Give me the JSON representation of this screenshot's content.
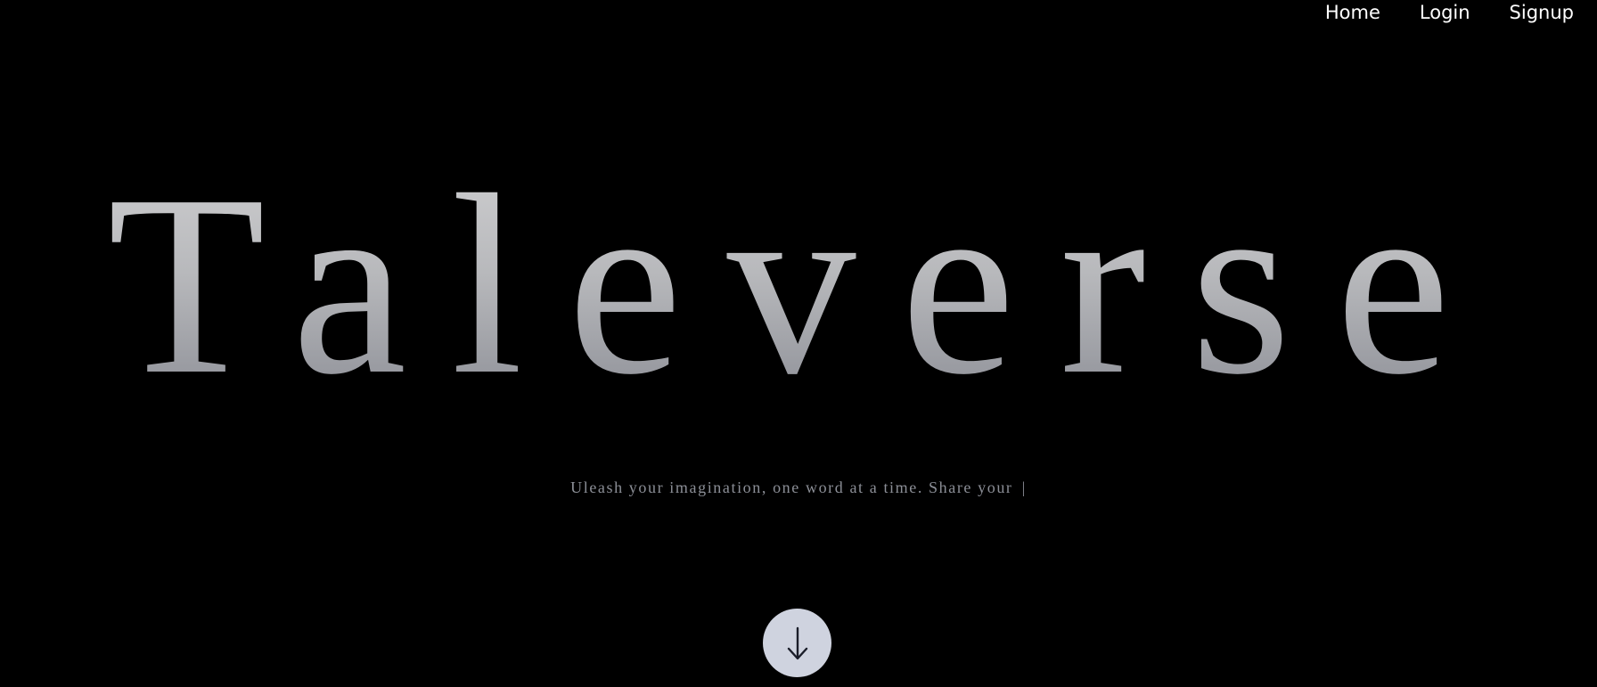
{
  "nav": {
    "items": [
      {
        "label": "Home"
      },
      {
        "label": "Login"
      },
      {
        "label": "Signup"
      }
    ]
  },
  "hero": {
    "title": "Taleverse",
    "tagline": "Uleash your imagination, one word at a time. Share your",
    "caret": "|"
  },
  "scroll_button": {
    "icon": "arrow-down-icon"
  },
  "colors": {
    "background": "#000000",
    "nav_text": "#ffffff",
    "title_gradient_top": "#cfcfd1",
    "title_gradient_bottom": "#8a8c94",
    "tagline": "#8c8f97",
    "scroll_button_bg": "#cfd3df",
    "scroll_arrow": "#1a1d29"
  }
}
